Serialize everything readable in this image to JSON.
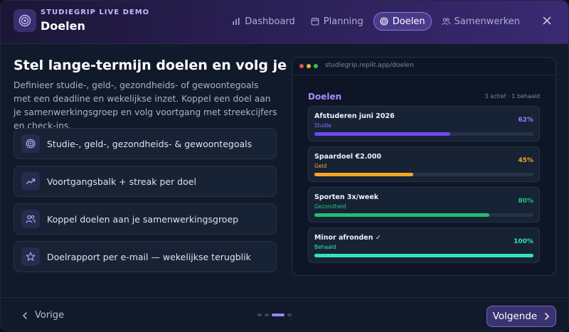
{
  "header": {
    "brand_sub": "STUDIEGRIP LIVE DEMO",
    "title": "Doelen",
    "nav": [
      {
        "label": "Dashboard",
        "icon": "bar-chart-icon"
      },
      {
        "label": "Planning",
        "icon": "calendar-icon"
      },
      {
        "label": "Doelen",
        "icon": "target-icon",
        "active": true
      },
      {
        "label": "Samenwerken",
        "icon": "users-icon"
      }
    ]
  },
  "main": {
    "headline": "Stel lange-termijn doelen en volg je groei",
    "description": "Definieer studie-, geld-, gezondheids- of gewoontegoals met een deadline en wekelijkse inzet. Koppel een doel aan je samenwerkingsgroep en volg voortgang met streekcijfers en check-ins.",
    "features": [
      {
        "label": "Studie-, geld-, gezondheids- & gewoontegoals",
        "icon": "target-icon"
      },
      {
        "label": "Voortgangsbalk + streak per doel",
        "icon": "trending-up-icon"
      },
      {
        "label": "Koppel doelen aan je samenwerkingsgroep",
        "icon": "users-icon"
      },
      {
        "label": "Doelrapport per e-mail — wekelijkse terugblik",
        "icon": "star-icon"
      }
    ]
  },
  "preview": {
    "url": "studiegrip.replit.app/doelen",
    "title": "Doelen",
    "count": "3 actief · 1 behaald",
    "goals": [
      {
        "name": "Afstuderen juni 2026",
        "category": "Studie",
        "percent_label": "62%",
        "progress": 0.62,
        "color": "#6d4cf0",
        "cat_color": "#8b6cff",
        "pct_color": "#9a80ff"
      },
      {
        "name": "Spaardoel €2.000",
        "category": "Geld",
        "percent_label": "45%",
        "progress": 0.45,
        "color": "#f5a524",
        "cat_color": "#f5a524",
        "pct_color": "#f5a524"
      },
      {
        "name": "Sporten 3x/week",
        "category": "Gezondheid",
        "percent_label": "80%",
        "progress": 0.8,
        "color": "#1fbf75",
        "cat_color": "#22c77c",
        "pct_color": "#22c77c"
      },
      {
        "name": "Minor afronden ✓",
        "category": "Behaald",
        "percent_label": "100%",
        "progress": 1.0,
        "color": "#2ee6b5",
        "cat_color": "#2ee6b5",
        "pct_color": "#2ee6b5"
      }
    ]
  },
  "footer": {
    "prev_label": "Vorige",
    "next_label": "Volgende",
    "pages": 4,
    "current_page": 3
  }
}
